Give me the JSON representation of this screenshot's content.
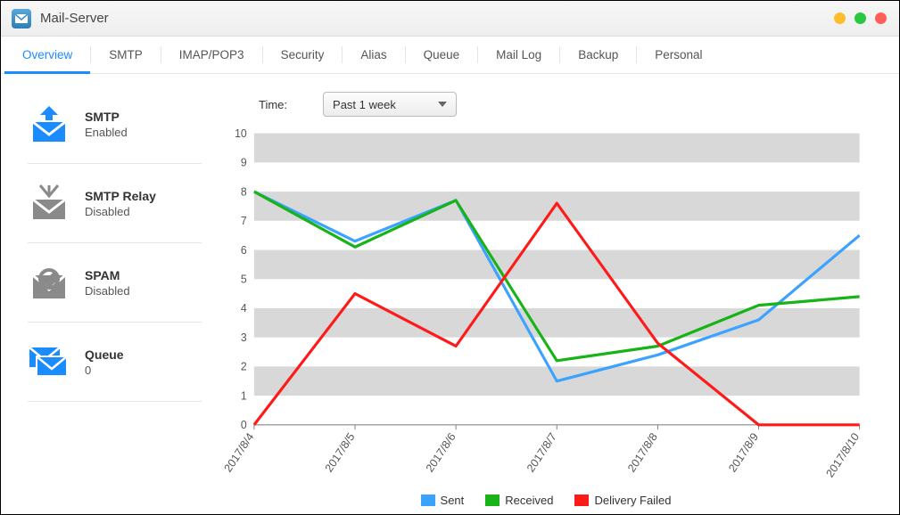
{
  "app": {
    "title": "Mail-Server"
  },
  "tabs": [
    {
      "label": "Overview",
      "active": true
    },
    {
      "label": "SMTP"
    },
    {
      "label": "IMAP/POP3"
    },
    {
      "label": "Security"
    },
    {
      "label": "Alias"
    },
    {
      "label": "Queue"
    },
    {
      "label": "Mail Log"
    },
    {
      "label": "Backup"
    },
    {
      "label": "Personal"
    }
  ],
  "sidebar": {
    "items": [
      {
        "icon": "smtp-send-icon",
        "title": "SMTP",
        "status": "Enabled",
        "color": "#1a8cff"
      },
      {
        "icon": "smtp-relay-icon",
        "title": "SMTP Relay",
        "status": "Disabled",
        "color": "#8a8a8a"
      },
      {
        "icon": "spam-icon",
        "title": "SPAM",
        "status": "Disabled",
        "color": "#8a8a8a"
      },
      {
        "icon": "queue-icon",
        "title": "Queue",
        "status": "0",
        "color": "#1a8cff"
      }
    ]
  },
  "toolbar": {
    "time_label": "Time:",
    "time_value": "Past 1 week"
  },
  "legend": {
    "sent": "Sent",
    "received": "Received",
    "failed": "Delivery Failed",
    "sent_color": "#3ba3ff",
    "received_color": "#17b317",
    "failed_color": "#ff1a1a"
  },
  "chart_data": {
    "type": "line",
    "categories": [
      "2017/8/4",
      "2017/8/5",
      "2017/8/6",
      "2017/8/7",
      "2017/8/8",
      "2017/8/9",
      "2017/8/10"
    ],
    "series": [
      {
        "name": "Sent",
        "color": "#3ba3ff",
        "values": [
          8.0,
          6.3,
          7.7,
          1.5,
          2.4,
          3.6,
          6.5
        ]
      },
      {
        "name": "Received",
        "color": "#17b317",
        "values": [
          8.0,
          6.1,
          7.7,
          2.2,
          2.7,
          4.1,
          4.4
        ]
      },
      {
        "name": "Delivery Failed",
        "color": "#ff1a1a",
        "values": [
          0.0,
          4.5,
          2.7,
          7.6,
          2.8,
          0.0,
          0.0
        ]
      }
    ],
    "ylim": [
      0,
      10
    ],
    "yticks": [
      0,
      1,
      2,
      3,
      4,
      5,
      6,
      7,
      8,
      9,
      10
    ],
    "xlabel": "",
    "ylabel": "",
    "title": ""
  }
}
